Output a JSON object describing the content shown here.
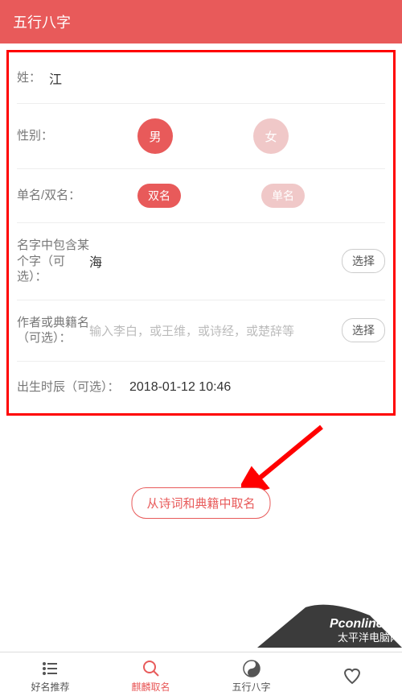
{
  "header": {
    "title": "五行八字"
  },
  "form": {
    "surname": {
      "label": "姓：",
      "value": "江"
    },
    "gender": {
      "label": "性别：",
      "male": "男",
      "female": "女",
      "selected": "male"
    },
    "nameType": {
      "label": "单名/双名：",
      "double": "双名",
      "single": "单名",
      "selected": "double"
    },
    "containChar": {
      "label": "名字中包含某个字（可选）：",
      "value": "海",
      "button": "选择"
    },
    "author": {
      "label": "作者或典籍名（可选）：",
      "placeholder": "输入李白，或王维，或诗经，或楚辞等",
      "button": "选择"
    },
    "birth": {
      "label": "出生时辰（可选）：",
      "value": "2018-01-12 10:46"
    }
  },
  "mainButton": "从诗词和典籍中取名",
  "tabs": [
    {
      "label": "好名推荐"
    },
    {
      "label": "麒麟取名"
    },
    {
      "label": "五行八字"
    },
    {
      "label": ""
    }
  ],
  "watermark": {
    "line1": "Pconline",
    "line2": "太平洋电脑网"
  }
}
